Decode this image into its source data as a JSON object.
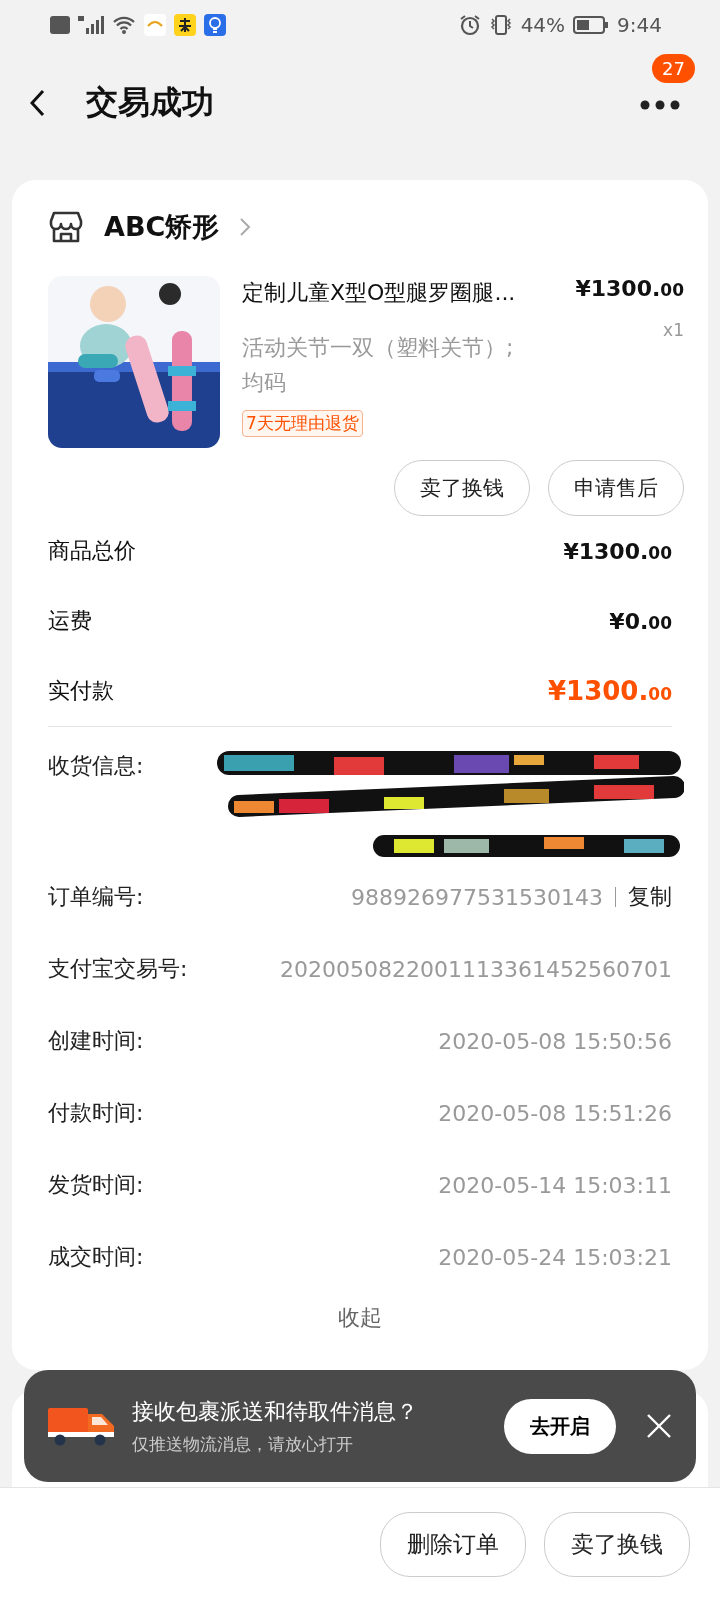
{
  "status_bar": {
    "battery": "44%",
    "time": "9:44"
  },
  "header": {
    "title": "交易成功",
    "badge": "27"
  },
  "shop": {
    "name": "ABC矫形"
  },
  "product": {
    "title": "定制儿童X型O型腿罗圈腿...",
    "price_main": "¥1300.",
    "price_cents": "00",
    "quantity": "x1",
    "spec": "活动关节一双（塑料关节）;\n均码",
    "tag": "7天无理由退货",
    "actions": [
      "卖了换钱",
      "申请售后"
    ]
  },
  "totals": [
    {
      "label": "商品总价",
      "main": "¥1300.",
      "cents": "00",
      "kind": "normal"
    },
    {
      "label": "运费",
      "main": "¥0.",
      "cents": "00",
      "kind": "normal"
    },
    {
      "label": "实付款",
      "main": "¥1300.",
      "cents": "00",
      "kind": "paid"
    }
  ],
  "shipping": {
    "label": "收货信息:",
    "redacted": true
  },
  "details": [
    {
      "label": "订单编号:",
      "value": "988926977531530143",
      "action": "复制"
    },
    {
      "label": "支付宝交易号:",
      "value": "2020050822001113361452560701"
    },
    {
      "label": "创建时间:",
      "value": "2020-05-08 15:50:56"
    },
    {
      "label": "付款时间:",
      "value": "2020-05-08 15:51:26"
    },
    {
      "label": "发货时间:",
      "value": "2020-05-14 15:03:11"
    },
    {
      "label": "成交时间:",
      "value": "2020-05-24 15:03:21"
    }
  ],
  "collapse": "收起",
  "toast": {
    "title": "接收包裹派送和待取件消息？",
    "subtitle": "仅推送物流消息，请放心打开",
    "button": "去开启"
  },
  "bottom_buttons": [
    "删除订单",
    "卖了换钱"
  ]
}
